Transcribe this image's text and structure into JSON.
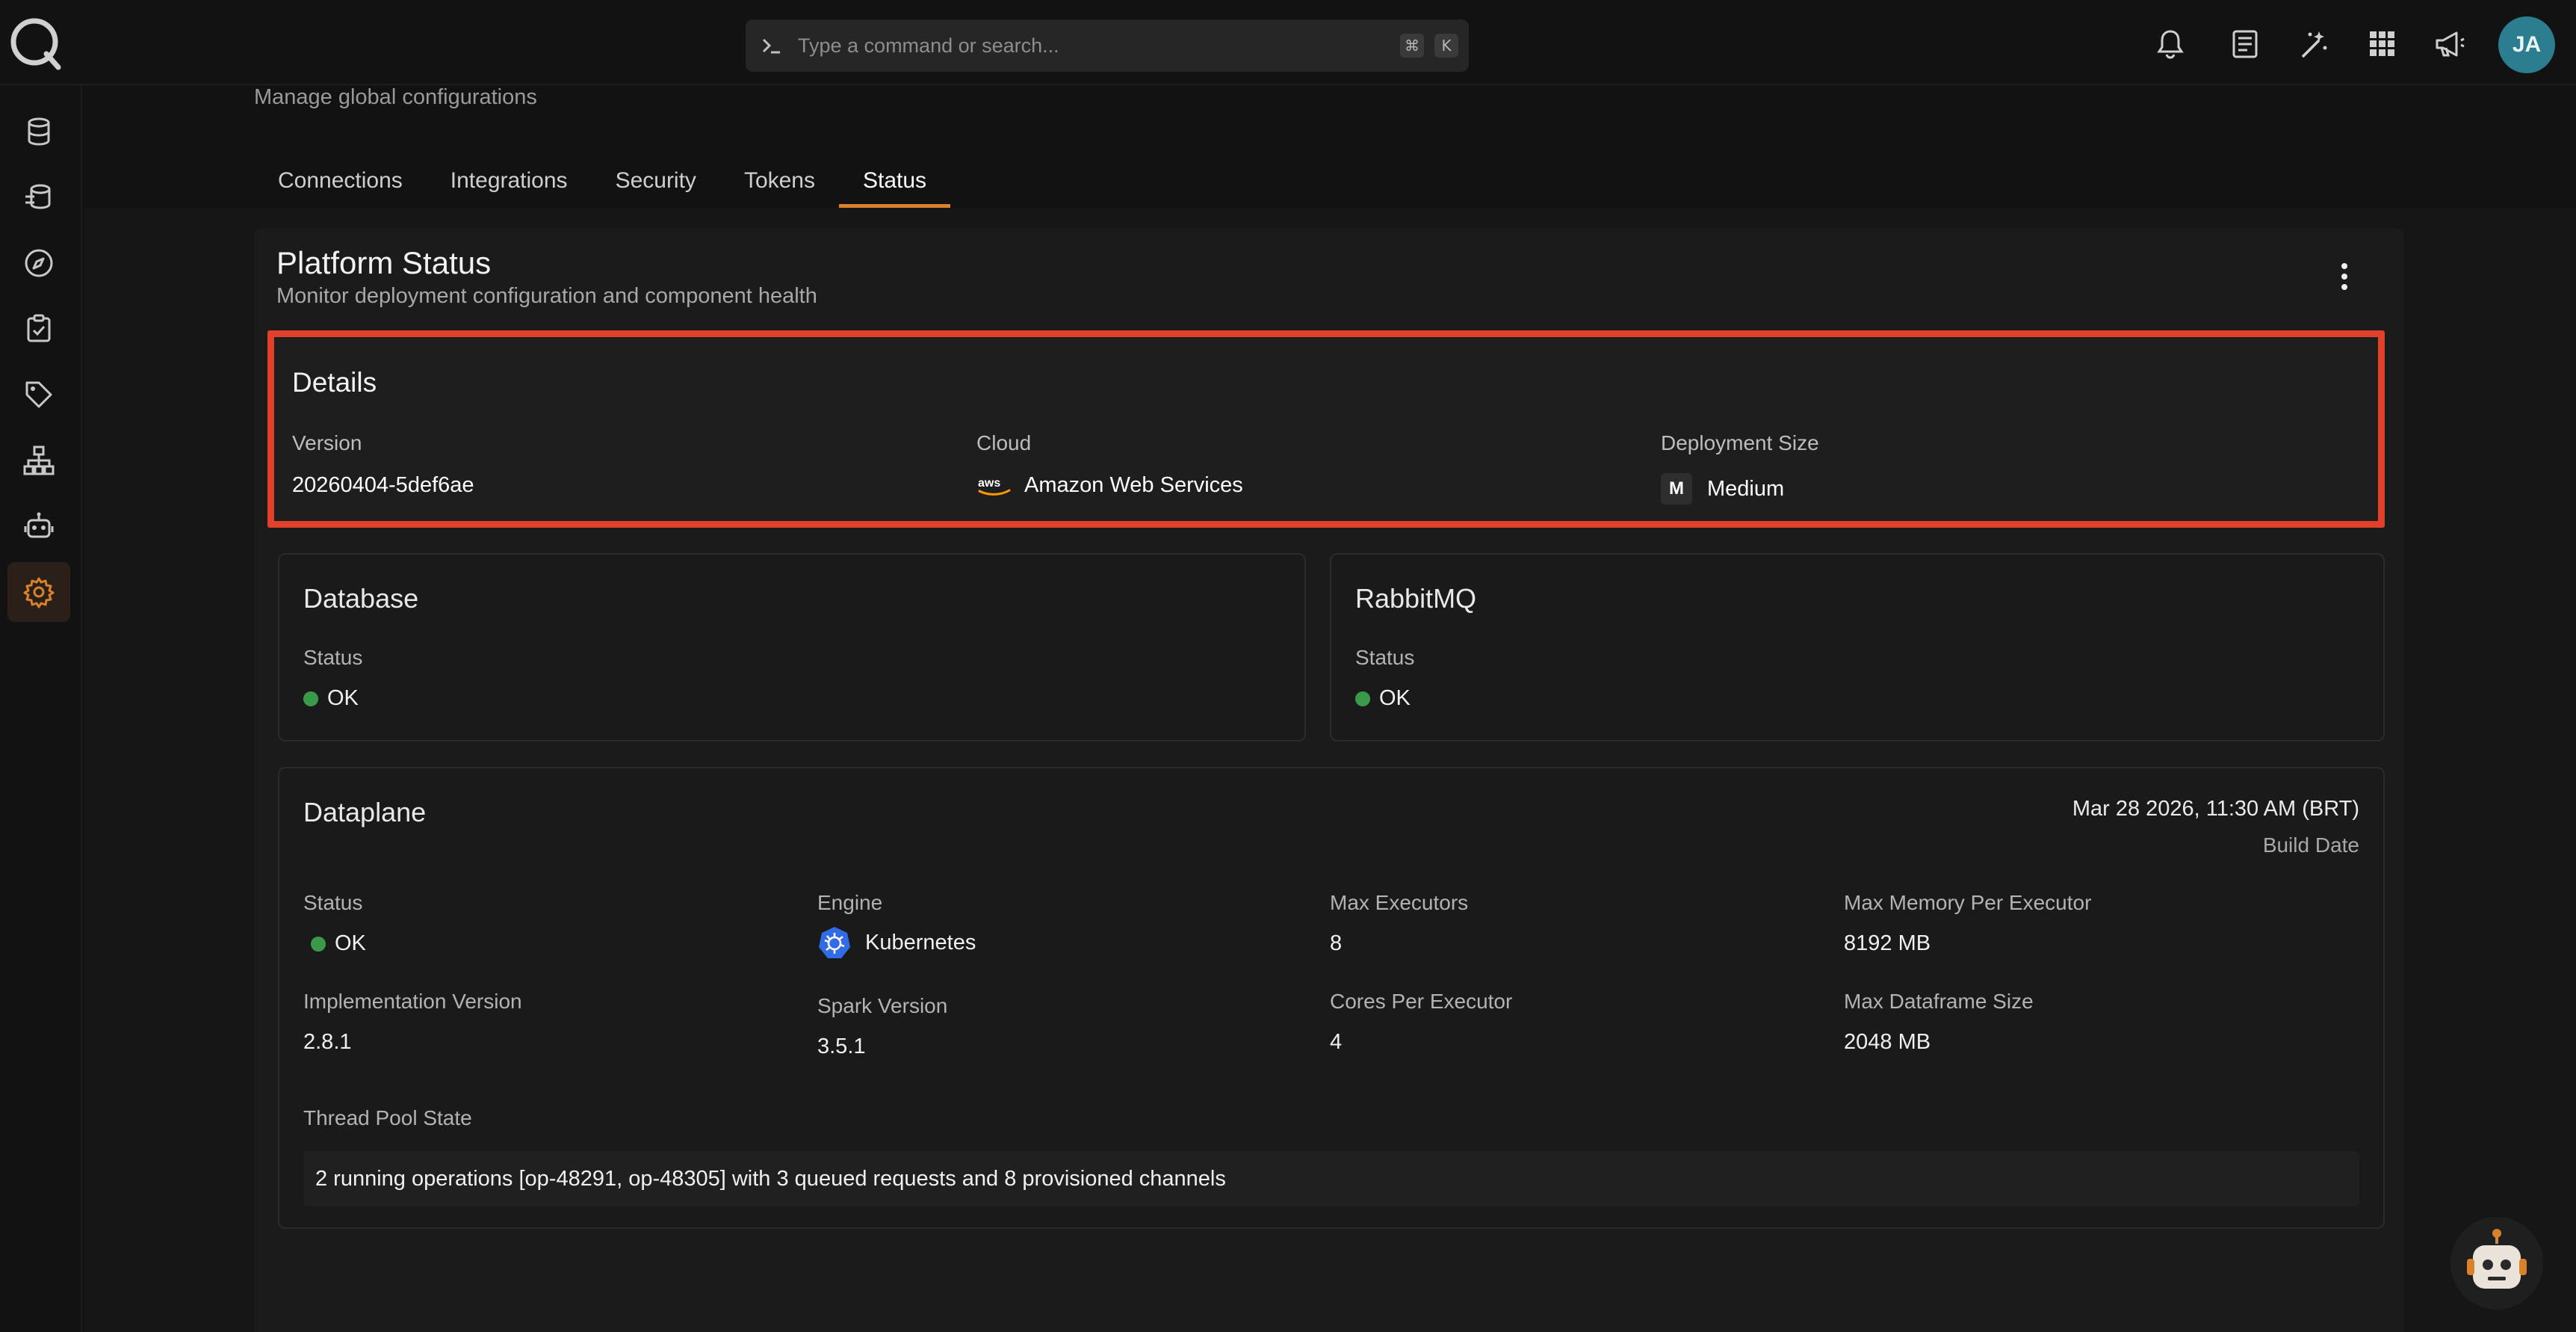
{
  "topbar": {
    "search_placeholder": "Type a command or search...",
    "shortcut_cmd": "⌘",
    "shortcut_key": "K",
    "avatar_initials": "JA"
  },
  "sidebar": {
    "items": [
      {
        "icon": "database-icon"
      },
      {
        "icon": "datasets-icon"
      },
      {
        "icon": "compass-icon"
      },
      {
        "icon": "checklist-icon"
      },
      {
        "icon": "tag-icon"
      },
      {
        "icon": "hierarchy-icon"
      },
      {
        "icon": "robot-icon"
      },
      {
        "icon": "gear-icon",
        "active": true
      }
    ]
  },
  "page": {
    "subtitle": "Manage global configurations",
    "tabs": [
      "Connections",
      "Integrations",
      "Security",
      "Tokens",
      "Status"
    ],
    "active_tab": "Status"
  },
  "platform": {
    "title": "Platform Status",
    "subtitle": "Monitor deployment configuration and component health"
  },
  "details": {
    "title": "Details",
    "version_label": "Version",
    "version_value": "20260404-5def6ae",
    "cloud_label": "Cloud",
    "cloud_value": "Amazon Web Services",
    "cloud_logo_text": "aws",
    "size_label": "Deployment Size",
    "size_value": "Medium",
    "size_badge": "M"
  },
  "database": {
    "title": "Database",
    "status_label": "Status",
    "status_value": "OK"
  },
  "rabbitmq": {
    "title": "RabbitMQ",
    "status_label": "Status",
    "status_value": "OK"
  },
  "dataplane": {
    "title": "Dataplane",
    "build_date_value": "Mar 28 2026, 11:30 AM (BRT)",
    "build_date_label": "Build Date",
    "status_label": "Status",
    "status_value": "OK",
    "engine_label": "Engine",
    "engine_value": "Kubernetes",
    "max_executors_label": "Max Executors",
    "max_executors_value": "8",
    "max_memory_label": "Max Memory Per Executor",
    "max_memory_value": "8192 MB",
    "impl_version_label": "Implementation Version",
    "impl_version_value": "2.8.1",
    "spark_version_label": "Spark Version",
    "spark_version_value": "3.5.1",
    "cores_label": "Cores Per Executor",
    "cores_value": "4",
    "max_df_label": "Max Dataframe Size",
    "max_df_value": "2048 MB",
    "thread_pool_label": "Thread Pool State",
    "thread_pool_value": "2 running operations [op-48291, op-48305] with 3 queued requests and 8 provisioned channels"
  },
  "colors": {
    "accent": "#d9822b",
    "highlight_border": "#e1412b",
    "ok": "#3a9a4a",
    "avatar": "#2b7d8f"
  }
}
